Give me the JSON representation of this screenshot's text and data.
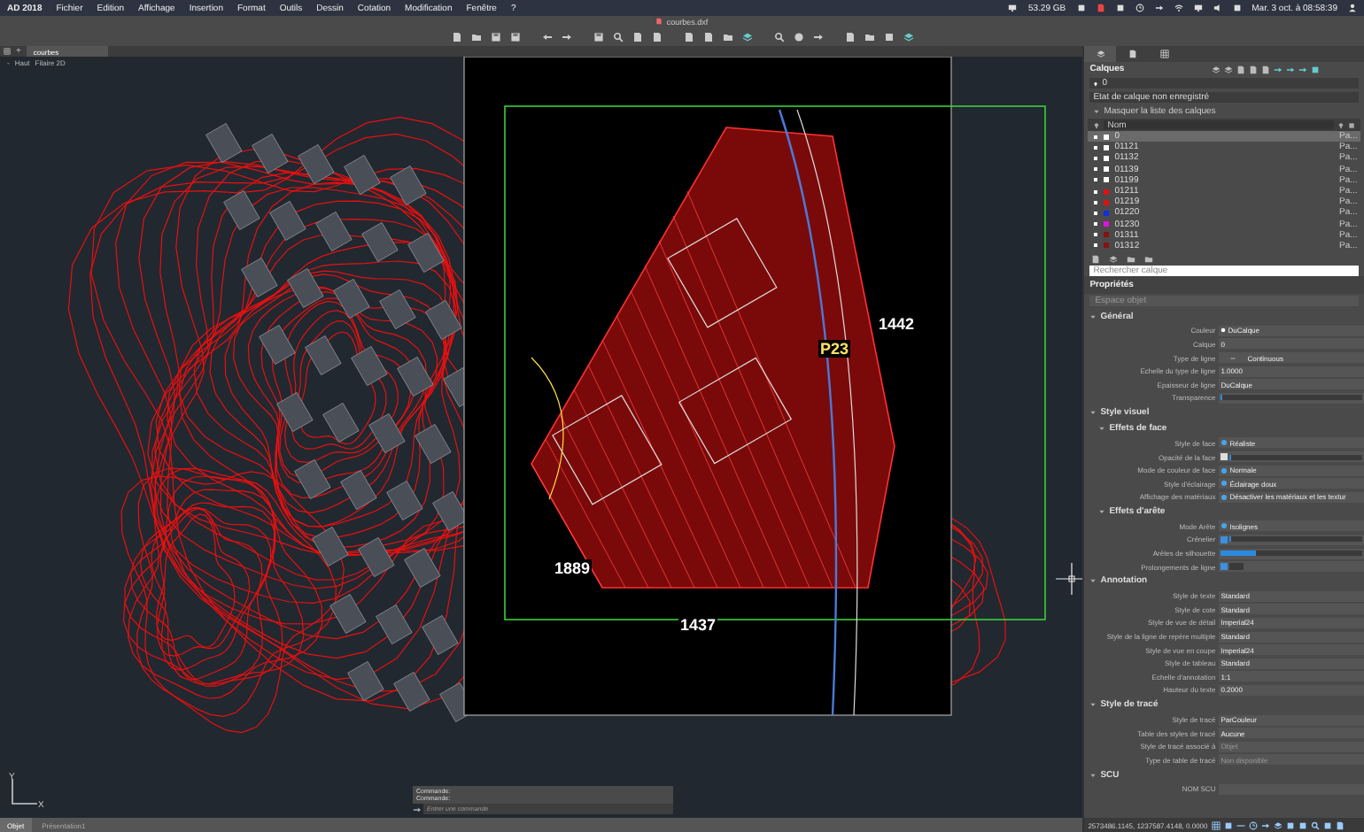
{
  "menubar": {
    "app": "AD 2018",
    "menus": [
      "Fichier",
      "Edition",
      "Affichage",
      "Insertion",
      "Format",
      "Outils",
      "Dessin",
      "Cotation",
      "Modification",
      "Fenêtre",
      "?"
    ],
    "storage": "53.29 GB",
    "clock": "Mar. 3 oct. à 08:58:39"
  },
  "toolbar": {
    "file_title": "courbes.dxf"
  },
  "doc_tabs": [
    {
      "label": "courbes",
      "selected": true
    }
  ],
  "add_tab": "+",
  "viewport": {
    "controls": [
      "-",
      "Haut",
      "Filaire 2D"
    ],
    "labels": [
      "1442",
      "P23",
      "1889",
      "1437"
    ],
    "axis_labels": [
      "Y",
      "X"
    ]
  },
  "command": {
    "history": [
      "Commande:",
      "Commande:"
    ],
    "placeholder": "Entrer une commande"
  },
  "layout_tabs": [
    {
      "label": "Objet",
      "selected": true
    },
    {
      "label": "Présentation1",
      "selected": false
    }
  ],
  "panel_tabs": [
    {
      "selected": true
    },
    {
      "selected": false
    },
    {
      "selected": false
    }
  ],
  "layers": {
    "title": "Calques",
    "current": "0",
    "state": "Etat de calque non enregistré",
    "toggle": "Masquer la liste des calques",
    "column": "Nom",
    "rows": [
      {
        "name": "0",
        "color": "#ffffff",
        "selected": true,
        "plot": "Pa..."
      },
      {
        "name": "01121",
        "color": "#ffffff",
        "selected": false,
        "plot": "Pa..."
      },
      {
        "name": "01132",
        "color": "#ffffff",
        "selected": false,
        "plot": "Pa..."
      },
      {
        "name": "01139",
        "color": "#ffffff",
        "selected": false,
        "plot": "Pa..."
      },
      {
        "name": "01199",
        "color": "#ffffff",
        "selected": false,
        "plot": "Pa..."
      },
      {
        "name": "01211",
        "color": "#e01010",
        "selected": false,
        "plot": "Pa..."
      },
      {
        "name": "01219",
        "color": "#e01010",
        "selected": false,
        "plot": "Pa..."
      },
      {
        "name": "01220",
        "color": "#1030e0",
        "selected": false,
        "plot": "Pa..."
      },
      {
        "name": "01230",
        "color": "#e010e0",
        "selected": false,
        "plot": "Pa..."
      },
      {
        "name": "01311",
        "color": "#8a1010",
        "selected": false,
        "plot": "Pa..."
      },
      {
        "name": "01312",
        "color": "#8a1010",
        "selected": false,
        "plot": "Pa..."
      }
    ],
    "search_placeholder": "Rechercher calque"
  },
  "properties": {
    "title": "Propriétés",
    "selection": "Espace objet",
    "groups": [
      {
        "title": "Général",
        "expanded": true,
        "rows": [
          {
            "label": "Couleur",
            "kind": "swatch",
            "value": "DuCalque"
          },
          {
            "label": "Calque",
            "kind": "text",
            "value": "0"
          },
          {
            "label": "Type de ligne",
            "kind": "linetype",
            "value": "Continuous"
          },
          {
            "label": "Echelle du type de ligne",
            "kind": "text",
            "value": "1.0000"
          },
          {
            "label": "Epaisseur de ligne",
            "kind": "text",
            "value": "DuCalque"
          },
          {
            "label": "Transparence",
            "kind": "slider",
            "level": 0
          }
        ]
      },
      {
        "title": "Style visuel",
        "expanded": true,
        "groups": [
          {
            "title": "Effets de face",
            "expanded": true,
            "rows": [
              {
                "label": "Style de face",
                "kind": "icon",
                "value": "Réaliste"
              },
              {
                "label": "Opacité de la face",
                "kind": "checkslider",
                "checked": false,
                "level": 0
              },
              {
                "label": "Mode de couleur de face",
                "kind": "icon",
                "value": "Normale"
              },
              {
                "label": "Style d'éclairage",
                "kind": "icon",
                "value": "Éclairage doux"
              },
              {
                "label": "Affichage des matériaux",
                "kind": "icon",
                "value": "Désactiver les matériaux et les textur"
              }
            ]
          },
          {
            "title": "Effets d'arête",
            "expanded": true,
            "rows": [
              {
                "label": "Mode Arête",
                "kind": "icon",
                "value": "Isolignes"
              },
              {
                "label": "Crénelier",
                "kind": "checkslider",
                "checked": true,
                "level": 0
              },
              {
                "label": "Arêtes de silhouette",
                "kind": "slider",
                "level": 0.25
              },
              {
                "label": "Prolongements de ligne",
                "kind": "checks",
                "checked": true
              }
            ]
          }
        ]
      },
      {
        "title": "Annotation",
        "expanded": true,
        "rows": [
          {
            "label": "Style de texte",
            "kind": "text",
            "value": "Standard"
          },
          {
            "label": "Style de cote",
            "kind": "text",
            "value": "Standard"
          },
          {
            "label": "Style de vue de détail",
            "kind": "text",
            "value": "Imperial24"
          },
          {
            "label": "Style de la ligne de repère multiple",
            "kind": "text",
            "value": "Standard"
          },
          {
            "label": "Style de vue en coupe",
            "kind": "text",
            "value": "Imperial24"
          },
          {
            "label": "Style de tableau",
            "kind": "text",
            "value": "Standard"
          },
          {
            "label": "Echelle d'annotation",
            "kind": "text",
            "value": "1:1"
          },
          {
            "label": "Hauteur du texte",
            "kind": "text",
            "value": "0.2000"
          }
        ]
      },
      {
        "title": "Style de tracé",
        "expanded": true,
        "rows": [
          {
            "label": "Style de tracé",
            "kind": "text",
            "value": "ParCouleur"
          },
          {
            "label": "Table des styles de tracé",
            "kind": "text",
            "value": "Aucune"
          },
          {
            "label": "Style de tracé associé à",
            "kind": "text",
            "value": "Objet",
            "disabled": true
          },
          {
            "label": "Type de table de tracé",
            "kind": "text",
            "value": "Non disponible",
            "disabled": true
          }
        ]
      },
      {
        "title": "SCU",
        "expanded": true,
        "rows": [
          {
            "label": "NOM SCU",
            "kind": "text"
          }
        ]
      }
    ]
  },
  "status_bar": {
    "coordinates": "2573486.1145, 1237587.4148, 0.0000"
  }
}
